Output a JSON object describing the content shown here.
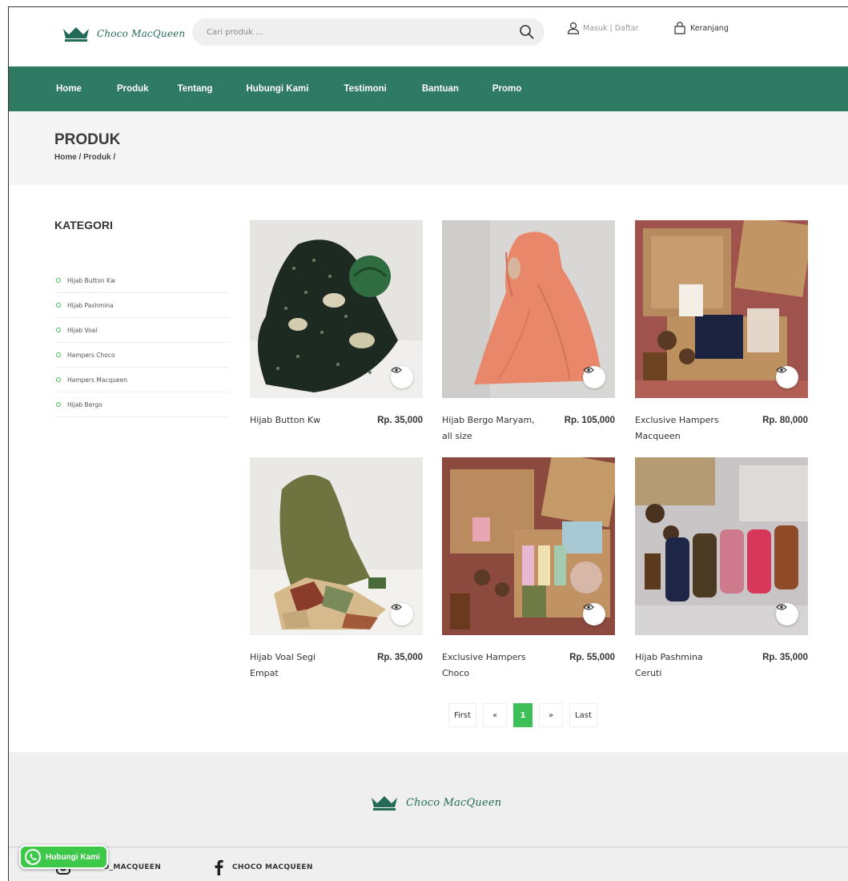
{
  "brand": {
    "name": "Choco MacQueen",
    "color": "#236b58",
    "accent": "#3fbf58",
    "nav_color": "#2f7a63"
  },
  "search": {
    "placeholder": "Cari produk ..."
  },
  "account": {
    "label": "Masuk | Daftar"
  },
  "cart": {
    "label": "Keranjang"
  },
  "nav": {
    "items": [
      {
        "label": "Home"
      },
      {
        "label": "Produk"
      },
      {
        "label": "Tentang"
      },
      {
        "label": "Hubungi Kami"
      },
      {
        "label": "Testimoni"
      },
      {
        "label": "Bantuan"
      },
      {
        "label": "Promo"
      }
    ]
  },
  "page": {
    "title": "PRODUK",
    "breadcrumb": "Home / Produk /"
  },
  "sidebar": {
    "title": "KATEGORI",
    "items": [
      {
        "label": "Hijab Button Kw"
      },
      {
        "label": "Hijab Pashmina"
      },
      {
        "label": "Hijab Voal"
      },
      {
        "label": "Hampers Choco"
      },
      {
        "label": "Hampers Macqueen"
      },
      {
        "label": "Hijab Bergo"
      }
    ]
  },
  "products": [
    {
      "name": "Hijab Button Kw",
      "price": "Rp. 35,000"
    },
    {
      "name": "Hijab Bergo Maryam, all size",
      "price": "Rp. 105,000"
    },
    {
      "name": "Exclusive Hampers Macqueen",
      "price": "Rp. 80,000"
    },
    {
      "name": "Hijab Voal Segi Empat",
      "price": "Rp. 35,000"
    },
    {
      "name": "Exclusive Hampers Choco",
      "price": "Rp. 55,000"
    },
    {
      "name": "Hijab Pashmina Ceruti",
      "price": "Rp. 35,000"
    }
  ],
  "pagination": {
    "first": "First",
    "prev": "«",
    "current": "1",
    "next": "»",
    "last": "Last"
  },
  "footer": {
    "brand": "Choco MacQueen",
    "instagram": "CHOCO_MACQUEEN",
    "facebook": "CHOCO MACQUEEN"
  },
  "whatsapp": {
    "label": "Hubungi Kami"
  }
}
